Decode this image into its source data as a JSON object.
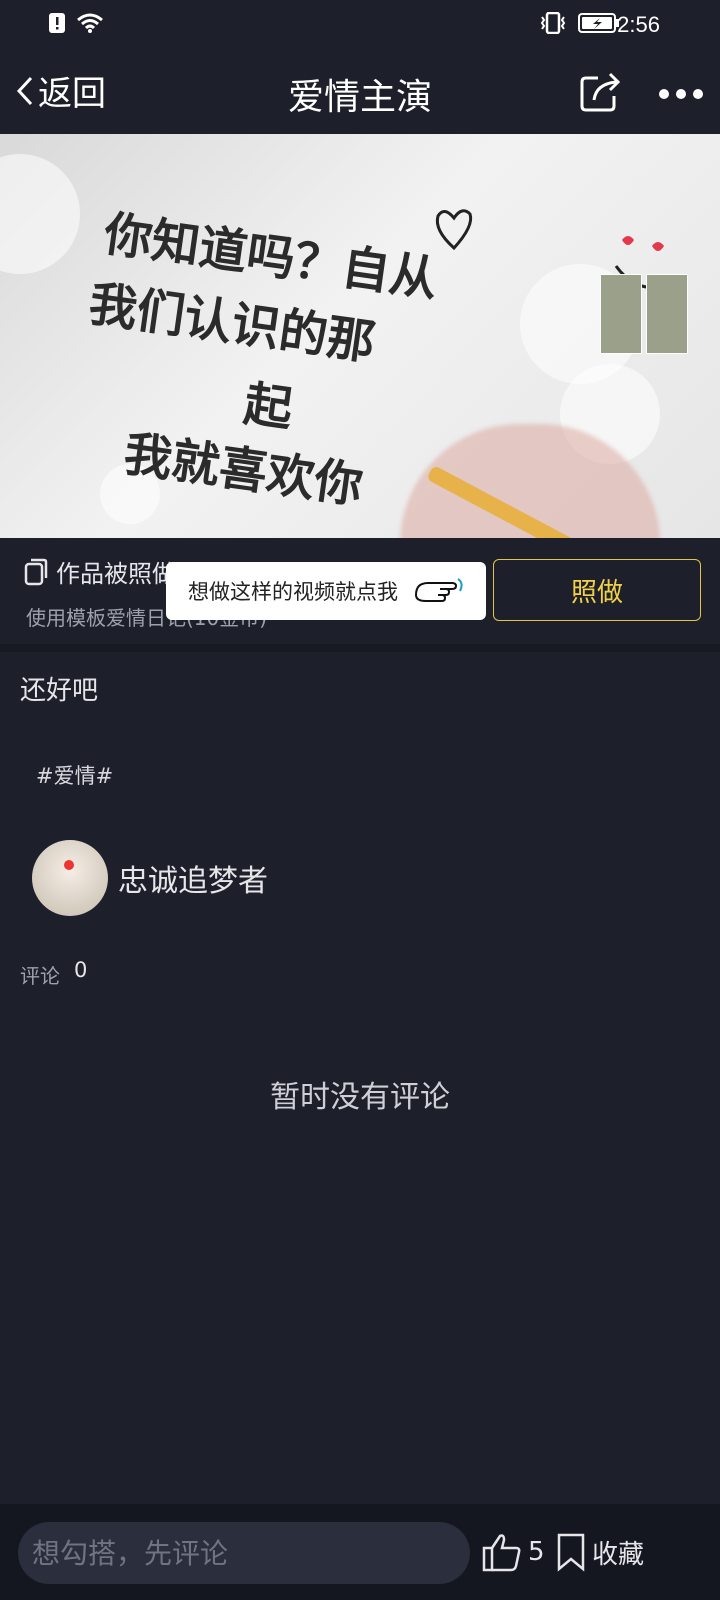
{
  "status": {
    "time": "2:56"
  },
  "nav": {
    "back_label": "返回",
    "title": "爱情主演"
  },
  "hero": {
    "line1": "你知道吗？自从",
    "line2": "我们认识的那",
    "line3": "起",
    "line4": "我就喜欢你"
  },
  "info": {
    "copied_text": "作品被照做",
    "template_text": "使用模板爱情日记(10金币)",
    "tooltip_text": "想做这样的视频就点我",
    "zhuo_button": "照做"
  },
  "post": {
    "description": "还好吧",
    "tag": "#爱情#",
    "author_name": "忠诚追梦者"
  },
  "comments": {
    "label": "评论",
    "count": "0",
    "empty_text": "暂时没有评论"
  },
  "bottom": {
    "input_placeholder": "想勾搭，先评论",
    "like_count": "5",
    "favorite_label": "收藏"
  }
}
